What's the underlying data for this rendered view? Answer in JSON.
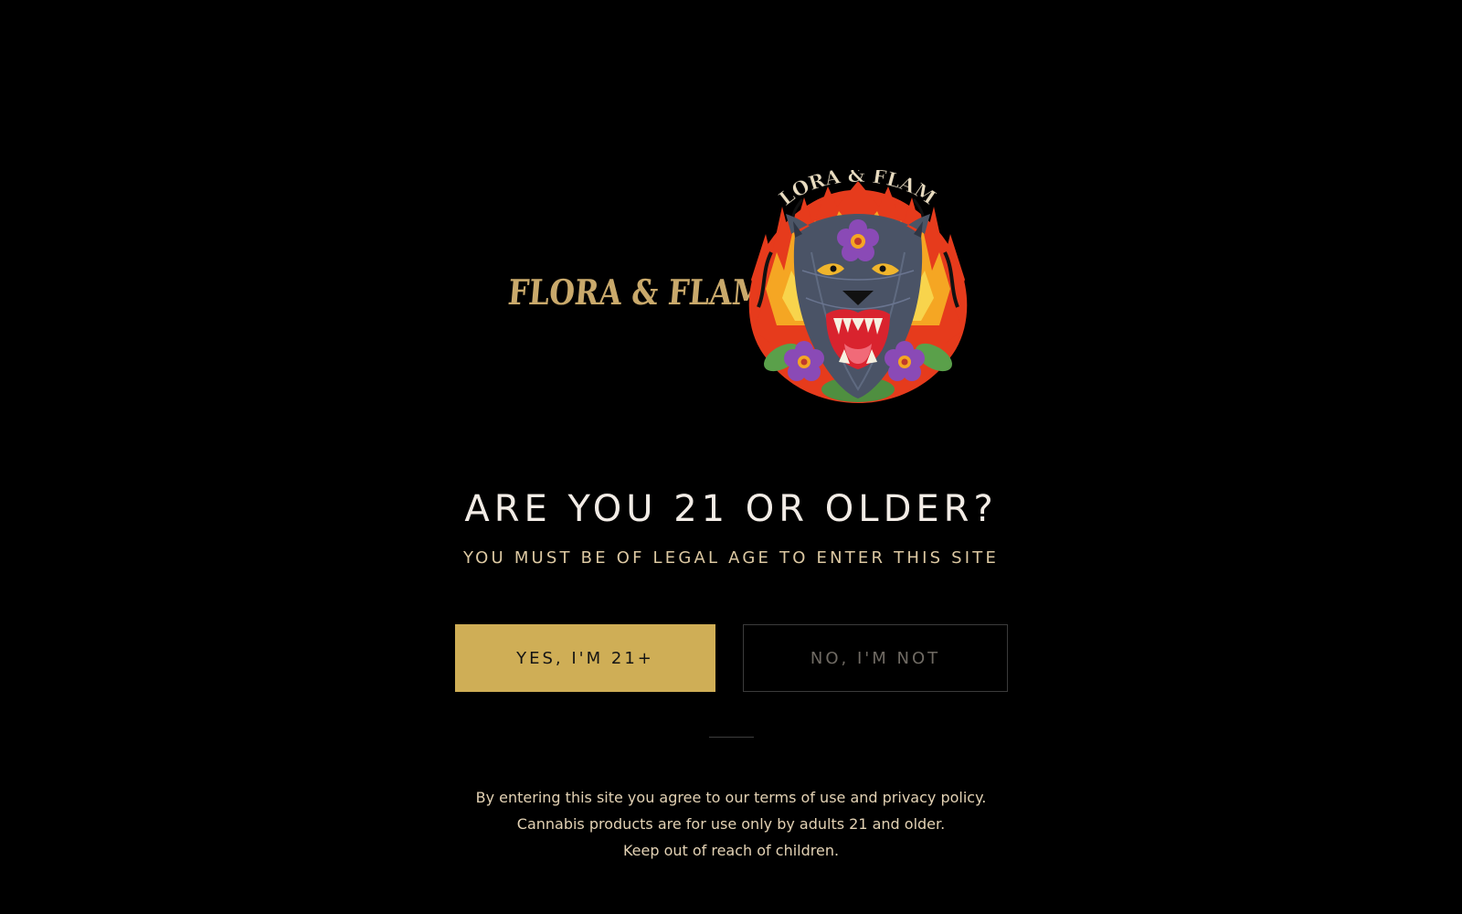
{
  "brand": {
    "name": "FLORA & FLAME",
    "emblem_icon": "panther-flame-emblem"
  },
  "age_gate": {
    "title": "ARE YOU 21 OR OLDER?",
    "subtitle": "YOU MUST BE OF LEGAL AGE TO ENTER THIS SITE",
    "confirm_label": "YES, I'M 21+",
    "deny_label": "NO, I'M NOT",
    "disclaimer": [
      "By entering this site you agree to our terms of use and privacy policy.",
      "Cannabis products are for use only by adults 21 and older.",
      "Keep out of reach of children."
    ]
  },
  "colors": {
    "background": "#000000",
    "accent_gold": "#cfae56",
    "wordmark_tan": "#c9a96b"
  }
}
